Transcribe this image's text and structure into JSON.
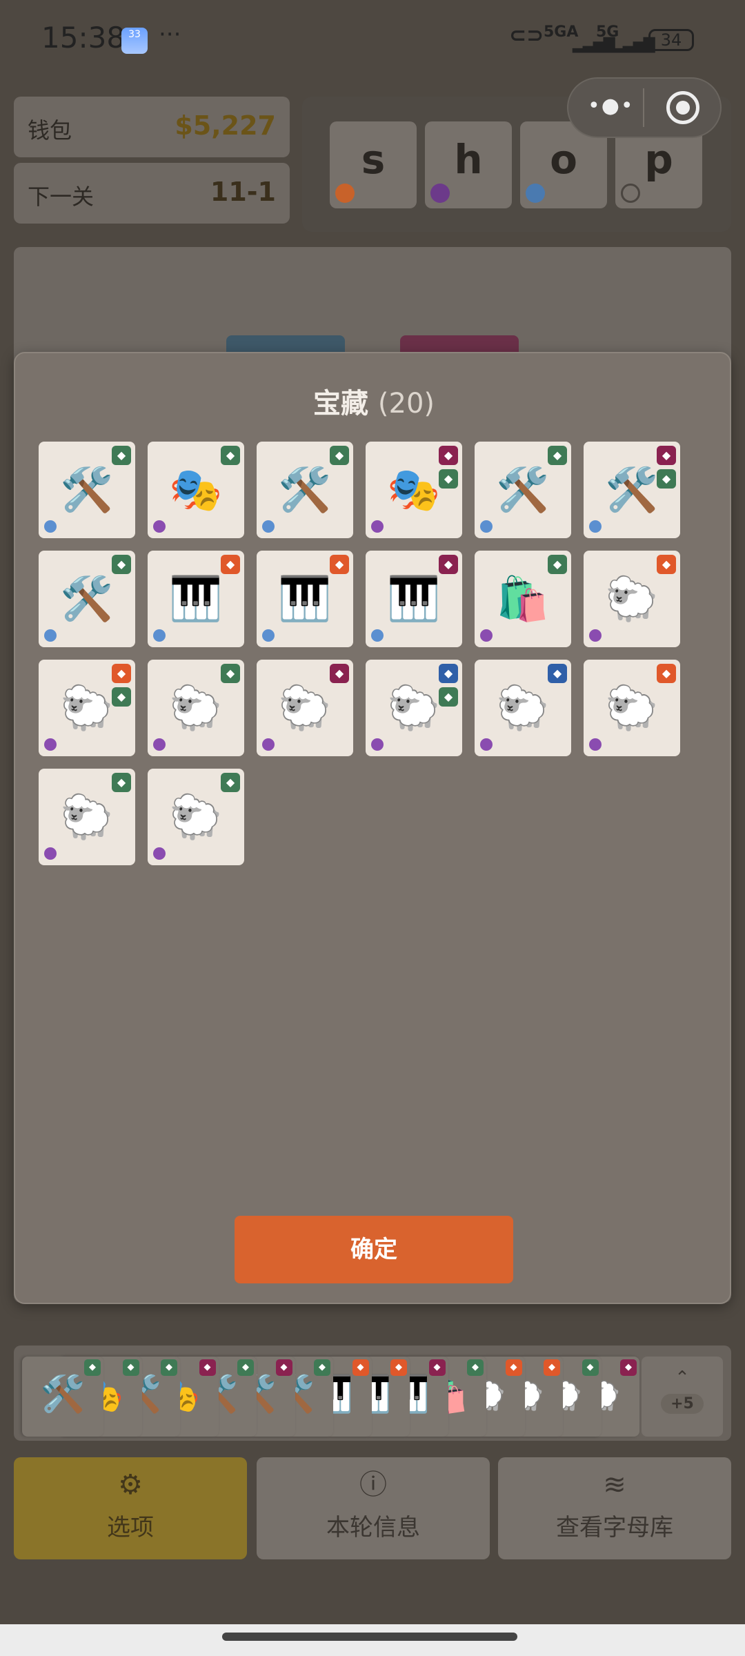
{
  "status": {
    "time": "15:38",
    "weather_num": "33",
    "more": "···",
    "net1": "5GA",
    "net2": "5G",
    "battery": "34"
  },
  "capsule": {
    "more_icon": "ellipsis-icon",
    "close_icon": "target-icon"
  },
  "wallet": {
    "label": "钱包",
    "value": "$5,227"
  },
  "next_level": {
    "label": "下一关",
    "value": "11-1"
  },
  "letters": [
    {
      "char": "s",
      "dot_color": "#c8622a"
    },
    {
      "char": "h",
      "dot_color": "#6c3a8a"
    },
    {
      "char": "o",
      "dot_color": "#4a7ab0"
    },
    {
      "char": "p",
      "dot_color": "transparent"
    }
  ],
  "modal": {
    "title": "宝藏",
    "count": "(20)",
    "confirm": "确定",
    "cards": [
      {
        "emoji": "🛠️",
        "dot": "#5b8fd0",
        "badges": [
          "#3f7a55"
        ]
      },
      {
        "emoji": "🎭",
        "dot": "#8a4cb0",
        "badges": [
          "#3f7a55"
        ]
      },
      {
        "emoji": "🛠️",
        "dot": "#5b8fd0",
        "badges": [
          "#3f7a55"
        ]
      },
      {
        "emoji": "🎭",
        "dot": "#8a4cb0",
        "badges": [
          "#8a2250",
          "#3f7a55"
        ]
      },
      {
        "emoji": "🛠️",
        "dot": "#5b8fd0",
        "badges": [
          "#3f7a55"
        ]
      },
      {
        "emoji": "🛠️",
        "dot": "#5b8fd0",
        "badges": [
          "#8a2250",
          "#3f7a55"
        ]
      },
      {
        "emoji": "🛠️",
        "dot": "#5b8fd0",
        "badges": [
          "#3f7a55"
        ]
      },
      {
        "emoji": "🎹",
        "dot": "#5b8fd0",
        "badges": [
          "#e0582a"
        ]
      },
      {
        "emoji": "🎹",
        "dot": "#5b8fd0",
        "badges": [
          "#e0582a"
        ]
      },
      {
        "emoji": "🎹",
        "dot": "#5b8fd0",
        "badges": [
          "#8a2250"
        ]
      },
      {
        "emoji": "🛍️",
        "dot": "#8a4cb0",
        "badges": [
          "#3f7a55"
        ]
      },
      {
        "emoji": "🐑",
        "dot": "#8a4cb0",
        "badges": [
          "#e0582a"
        ]
      },
      {
        "emoji": "🐑",
        "dot": "#8a4cb0",
        "badges": [
          "#e0582a",
          "#3f7a55"
        ]
      },
      {
        "emoji": "🐑",
        "dot": "#8a4cb0",
        "badges": [
          "#3f7a55"
        ]
      },
      {
        "emoji": "🐑",
        "dot": "#8a4cb0",
        "badges": [
          "#8a2250"
        ]
      },
      {
        "emoji": "🐑",
        "dot": "#8a4cb0",
        "badges": [
          "#2f5fa8",
          "#3f7a55"
        ]
      },
      {
        "emoji": "🐑",
        "dot": "#8a4cb0",
        "badges": [
          "#2f5fa8"
        ]
      },
      {
        "emoji": "🐑",
        "dot": "#8a4cb0",
        "badges": [
          "#e0582a"
        ]
      },
      {
        "emoji": "🐑",
        "dot": "#8a4cb0",
        "badges": [
          "#3f7a55"
        ]
      },
      {
        "emoji": "🐑",
        "dot": "#8a4cb0",
        "badges": [
          "#3f7a55"
        ]
      }
    ]
  },
  "hand": {
    "cards": [
      "🛠️",
      "🎭",
      "🛠️",
      "🎭",
      "🛠️",
      "🛠️",
      "🛠️",
      "🎹",
      "🎹",
      "🎹",
      "🛍️",
      "🐑",
      "🐑",
      "🐑",
      "🐑"
    ],
    "more_chevron": "⌃",
    "more_label": "+5"
  },
  "bottom": {
    "options": {
      "icon": "gear-icon",
      "label": "选项"
    },
    "round_info": {
      "icon": "info-icon",
      "label": "本轮信息"
    },
    "letter_bank": {
      "icon": "layers-icon",
      "label": "查看字母库"
    }
  }
}
